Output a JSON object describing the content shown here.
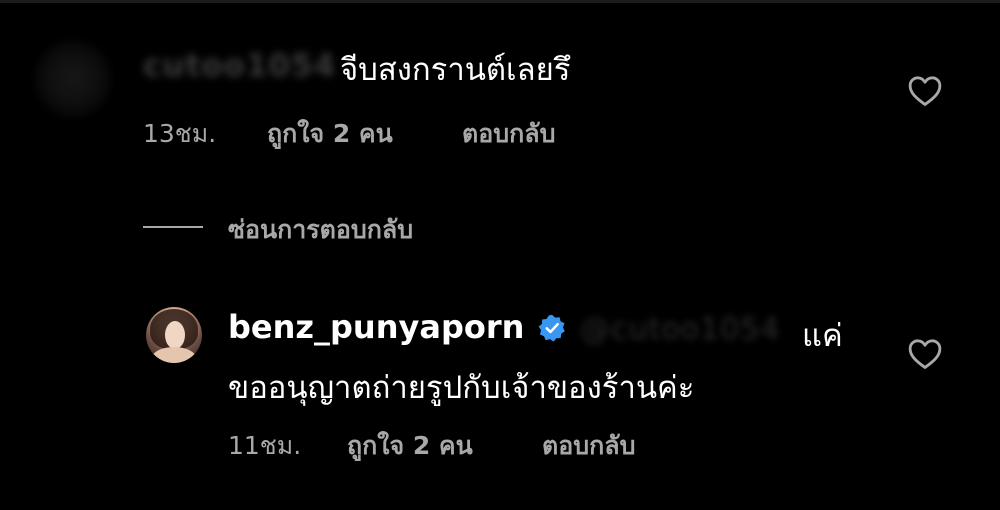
{
  "comment1": {
    "username_blurred": "cutoo1054",
    "text": "จีบสงกรานต์เลยรึ",
    "time": "13ชม.",
    "likes": "ถูกใจ 2 คน",
    "reply_label": "ตอบกลับ"
  },
  "hide_replies_label": "ซ่อนการตอบกลับ",
  "comment2": {
    "username": "benz_punyaporn",
    "mention_blurred": "@cutoo1054",
    "text_line1_tail": "แค่",
    "text_line2": "ขออนุญาตถ่ายรูปกับเจ้าของร้านค่ะ",
    "time": "11ชม.",
    "likes": "ถูกใจ 2 คน",
    "reply_label": "ตอบกลับ"
  },
  "icons": {
    "like": "heart-outline-icon",
    "verified": "verified-badge-icon"
  },
  "colors": {
    "background": "#000000",
    "primary_text": "#ffffff",
    "secondary_text": "#a8a8a8",
    "verified_blue": "#3897f0"
  }
}
